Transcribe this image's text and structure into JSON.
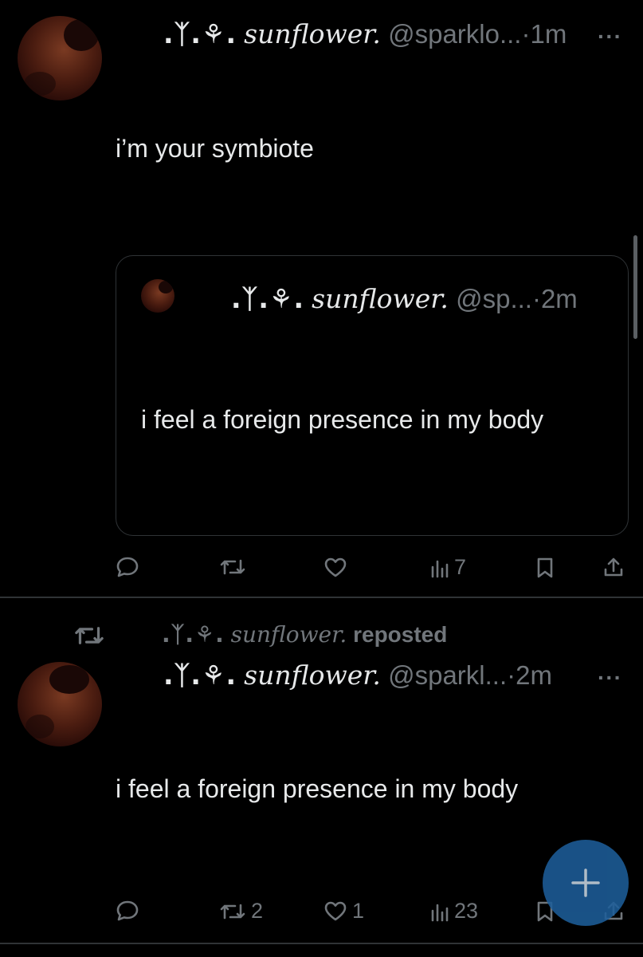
{
  "tweet1": {
    "deco": ".ᛉ.⚘.",
    "display_name": "sunflower.",
    "handle": "@sparklo...",
    "sep": "·",
    "time": "1m",
    "more": "···",
    "text": "i’m  your  symbiote",
    "quote": {
      "deco": ".ᛉ.⚘.",
      "display_name": "sunflower.",
      "handle": "@sp...",
      "sep": "·",
      "time": "2m",
      "text": "i feel a foreign presence in my body"
    },
    "actions": {
      "replies": "",
      "reposts": "",
      "likes": "",
      "views": "7"
    }
  },
  "repost_banner": {
    "deco": ".ᛉ.⚘.",
    "display_name": "sunflower.",
    "label": "reposted"
  },
  "tweet2": {
    "deco": ".ᛉ.⚘.",
    "display_name": "sunflower.",
    "handle": "@sparkl...",
    "sep": "·",
    "time": "2m",
    "more": "···",
    "text": "i feel a foreign presence in my body",
    "actions": {
      "replies": "",
      "reposts": "2",
      "likes": "1",
      "views": "23"
    }
  },
  "fab": {
    "icon": "plus-icon"
  },
  "colors": {
    "background": "#000000",
    "text": "#e7e9ea",
    "muted": "#71767b",
    "border": "#2f3336",
    "fab": "#1d5d99"
  }
}
